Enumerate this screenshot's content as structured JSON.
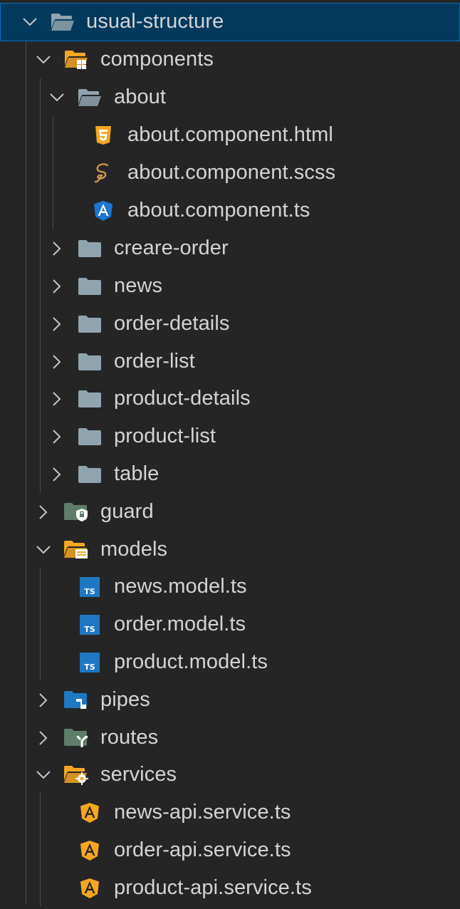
{
  "explorer": {
    "root": {
      "label": "usual-structure",
      "icon": "folder-open-icon",
      "expanded": true,
      "selected": true
    },
    "items": [
      {
        "id": "components",
        "label": "components",
        "icon": "folder-components-open-icon",
        "expanded": true
      },
      {
        "id": "about",
        "label": "about",
        "icon": "folder-open-icon",
        "expanded": true
      },
      {
        "id": "about-html",
        "label": "about.component.html",
        "icon": "html5-icon"
      },
      {
        "id": "about-scss",
        "label": "about.component.scss",
        "icon": "sass-icon"
      },
      {
        "id": "about-ts",
        "label": "about.component.ts",
        "icon": "angular-component-icon"
      },
      {
        "id": "creare-order",
        "label": "creare-order",
        "icon": "folder-icon",
        "expanded": false
      },
      {
        "id": "news",
        "label": "news",
        "icon": "folder-icon",
        "expanded": false
      },
      {
        "id": "order-details",
        "label": "order-details",
        "icon": "folder-icon",
        "expanded": false
      },
      {
        "id": "order-list",
        "label": "order-list",
        "icon": "folder-icon",
        "expanded": false
      },
      {
        "id": "product-details",
        "label": "product-details",
        "icon": "folder-icon",
        "expanded": false
      },
      {
        "id": "product-list",
        "label": "product-list",
        "icon": "folder-icon",
        "expanded": false
      },
      {
        "id": "table",
        "label": "table",
        "icon": "folder-icon",
        "expanded": false
      },
      {
        "id": "guard",
        "label": "guard",
        "icon": "folder-guard-icon",
        "expanded": false
      },
      {
        "id": "models",
        "label": "models",
        "icon": "folder-models-open-icon",
        "expanded": true
      },
      {
        "id": "news-model",
        "label": "news.model.ts",
        "icon": "typescript-icon"
      },
      {
        "id": "order-model",
        "label": "order.model.ts",
        "icon": "typescript-icon"
      },
      {
        "id": "product-model",
        "label": "product.model.ts",
        "icon": "typescript-icon"
      },
      {
        "id": "pipes",
        "label": "pipes",
        "icon": "folder-pipes-icon",
        "expanded": false
      },
      {
        "id": "routes",
        "label": "routes",
        "icon": "folder-routes-icon",
        "expanded": false
      },
      {
        "id": "services",
        "label": "services",
        "icon": "folder-services-open-icon",
        "expanded": true
      },
      {
        "id": "news-api",
        "label": "news-api.service.ts",
        "icon": "angular-service-icon"
      },
      {
        "id": "order-api",
        "label": "order-api.service.ts",
        "icon": "angular-service-icon"
      },
      {
        "id": "product-api",
        "label": "product-api.service.ts",
        "icon": "angular-service-icon"
      }
    ]
  },
  "colors": {
    "background": "#252526",
    "selection": "#04395e",
    "selection_border": "#0e6eb8",
    "text": "#d4d4d4",
    "folder": "#90a4ae",
    "folder_accent": "#f5a623",
    "html": "#e44d26",
    "sass": "#cd9a4f",
    "angular_component": "#1976d2",
    "angular_service": "#f5a623",
    "typescript": "#1e78c2"
  }
}
